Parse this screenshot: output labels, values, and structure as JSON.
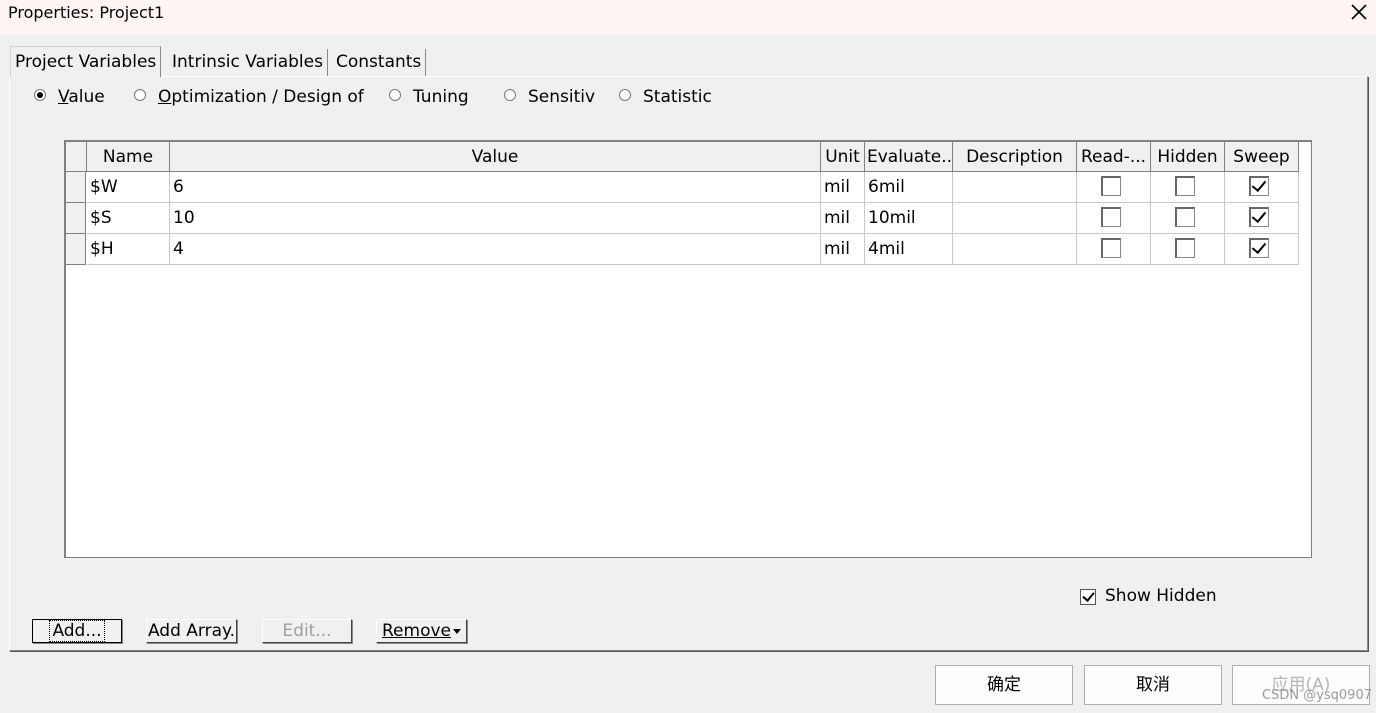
{
  "window": {
    "title": "Properties: Project1"
  },
  "tabs": [
    {
      "label": "Project Variables"
    },
    {
      "label": "Intrinsic Variables"
    },
    {
      "label": "Constants"
    }
  ],
  "radio_options": [
    {
      "label_ul": "V",
      "label_rest": "alue",
      "checked": true
    },
    {
      "label_ul": "O",
      "label_rest": "ptimization / Design of",
      "checked": false
    },
    {
      "label_ul": "",
      "label_rest": "Tuning",
      "checked": false
    },
    {
      "label_ul": "",
      "label_rest": "Sensitiv",
      "checked": false
    },
    {
      "label_ul": "",
      "label_rest": "Statistic",
      "checked": false
    }
  ],
  "table": {
    "columns": [
      "Name",
      "Value",
      "Unit",
      "Evaluate...",
      "Description",
      "Read-...",
      "Hidden",
      "Sweep"
    ],
    "rows": [
      {
        "name": "$W",
        "value": "6",
        "unit": "mil",
        "evaluated": "6mil",
        "description": "",
        "readonly": false,
        "hidden": false,
        "sweep": true
      },
      {
        "name": "$S",
        "value": "10",
        "unit": "mil",
        "evaluated": "10mil",
        "description": "",
        "readonly": false,
        "hidden": false,
        "sweep": true
      },
      {
        "name": "$H",
        "value": "4",
        "unit": "mil",
        "evaluated": "4mil",
        "description": "",
        "readonly": false,
        "hidden": false,
        "sweep": true
      }
    ]
  },
  "show_hidden": {
    "label": "Show Hidden",
    "checked": true
  },
  "buttons": {
    "add": "Add...",
    "add_array": "Add Array.",
    "edit": "Edit...",
    "remove": "Remove"
  },
  "dialog_buttons": {
    "ok": "确定",
    "cancel": "取消",
    "apply": "应用(A)"
  },
  "watermark": "CSDN @ysq0907"
}
